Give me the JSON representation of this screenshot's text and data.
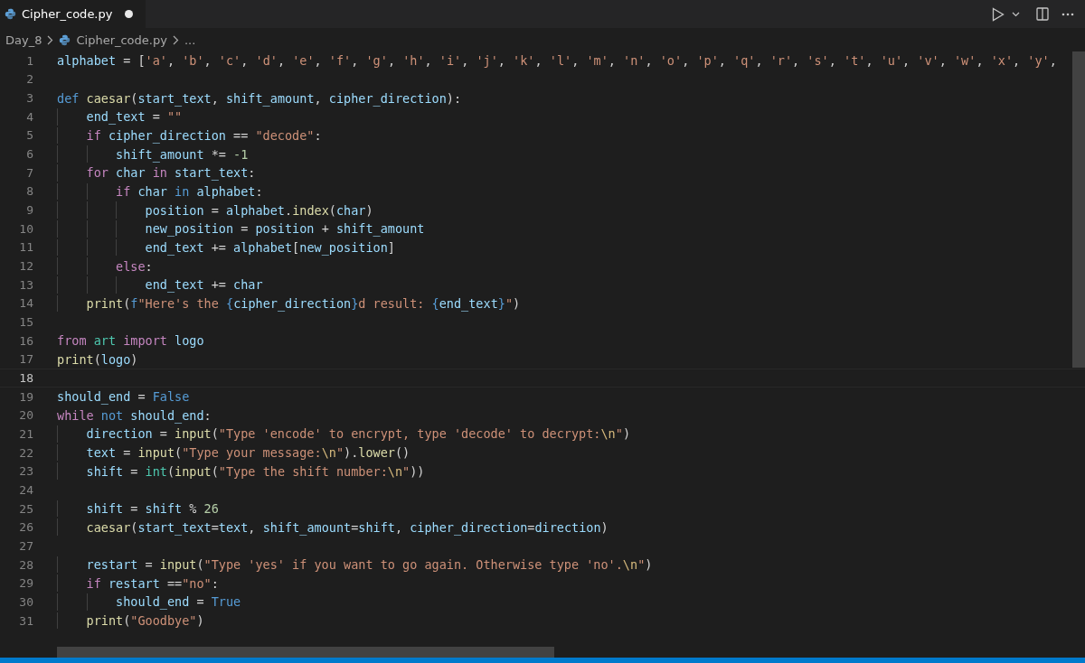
{
  "tabs": [
    {
      "label": "Cipher_code.py",
      "selected": true,
      "modified": true
    }
  ],
  "breadcrumbs": [
    "Day_8",
    "Cipher_code.py",
    "..."
  ],
  "lines": [
    {
      "number": "1",
      "current": false,
      "tokens": [
        {
          "kind": "variable",
          "text": "alphabet"
        },
        {
          "kind": "operator",
          "text": " = ["
        },
        {
          "kind": "string",
          "text": "'a'"
        },
        {
          "kind": "operator",
          "text": ", "
        },
        {
          "kind": "string",
          "text": "'b'"
        },
        {
          "kind": "operator",
          "text": ", "
        },
        {
          "kind": "string",
          "text": "'c'"
        },
        {
          "kind": "operator",
          "text": ", "
        },
        {
          "kind": "string",
          "text": "'d'"
        },
        {
          "kind": "operator",
          "text": ", "
        },
        {
          "kind": "string",
          "text": "'e'"
        },
        {
          "kind": "operator",
          "text": ", "
        },
        {
          "kind": "string",
          "text": "'f'"
        },
        {
          "kind": "operator",
          "text": ", "
        },
        {
          "kind": "string",
          "text": "'g'"
        },
        {
          "kind": "operator",
          "text": ", "
        },
        {
          "kind": "string",
          "text": "'h'"
        },
        {
          "kind": "operator",
          "text": ", "
        },
        {
          "kind": "string",
          "text": "'i'"
        },
        {
          "kind": "operator",
          "text": ", "
        },
        {
          "kind": "string",
          "text": "'j'"
        },
        {
          "kind": "operator",
          "text": ", "
        },
        {
          "kind": "string",
          "text": "'k'"
        },
        {
          "kind": "operator",
          "text": ", "
        },
        {
          "kind": "string",
          "text": "'l'"
        },
        {
          "kind": "operator",
          "text": ", "
        },
        {
          "kind": "string",
          "text": "'m'"
        },
        {
          "kind": "operator",
          "text": ", "
        },
        {
          "kind": "string",
          "text": "'n'"
        },
        {
          "kind": "operator",
          "text": ", "
        },
        {
          "kind": "string",
          "text": "'o'"
        },
        {
          "kind": "operator",
          "text": ", "
        },
        {
          "kind": "string",
          "text": "'p'"
        },
        {
          "kind": "operator",
          "text": ", "
        },
        {
          "kind": "string",
          "text": "'q'"
        },
        {
          "kind": "operator",
          "text": ", "
        },
        {
          "kind": "string",
          "text": "'r'"
        },
        {
          "kind": "operator",
          "text": ", "
        },
        {
          "kind": "string",
          "text": "'s'"
        },
        {
          "kind": "operator",
          "text": ", "
        },
        {
          "kind": "string",
          "text": "'t'"
        },
        {
          "kind": "operator",
          "text": ", "
        },
        {
          "kind": "string",
          "text": "'u'"
        },
        {
          "kind": "operator",
          "text": ", "
        },
        {
          "kind": "string",
          "text": "'v'"
        },
        {
          "kind": "operator",
          "text": ", "
        },
        {
          "kind": "string",
          "text": "'w'"
        },
        {
          "kind": "operator",
          "text": ", "
        },
        {
          "kind": "string",
          "text": "'x'"
        },
        {
          "kind": "operator",
          "text": ", "
        },
        {
          "kind": "string",
          "text": "'y'"
        },
        {
          "kind": "operator",
          "text": ","
        }
      ]
    },
    {
      "number": "2",
      "current": false
    },
    {
      "number": "3",
      "current": false,
      "tokens": [
        {
          "kind": "storage",
          "text": "def"
        },
        {
          "kind": "function",
          "text": " caesar"
        },
        {
          "kind": "operator",
          "text": "("
        },
        {
          "kind": "variable",
          "text": "start_text"
        },
        {
          "kind": "operator",
          "text": ", "
        },
        {
          "kind": "variable",
          "text": "shift_amount"
        },
        {
          "kind": "operator",
          "text": ", "
        },
        {
          "kind": "variable",
          "text": "cipher_direction"
        },
        {
          "kind": "operator",
          "text": "):"
        }
      ]
    },
    {
      "number": "4",
      "current": false,
      "tokens": [
        {
          "kind": "variable",
          "text": "    end_text"
        },
        {
          "kind": "operator",
          "text": " = "
        },
        {
          "kind": "string",
          "text": "\"\""
        }
      ]
    },
    {
      "number": "5",
      "current": false,
      "tokens": [
        {
          "kind": "keyword",
          "text": "    if"
        },
        {
          "kind": "variable",
          "text": " cipher_direction"
        },
        {
          "kind": "operator",
          "text": " == "
        },
        {
          "kind": "string",
          "text": "\"decode\""
        },
        {
          "kind": "operator",
          "text": ":"
        }
      ]
    },
    {
      "number": "6",
      "current": false,
      "tokens": [
        {
          "kind": "variable",
          "text": "        shift_amount"
        },
        {
          "kind": "operator",
          "text": " *= "
        },
        {
          "kind": "number",
          "text": "-1"
        }
      ]
    },
    {
      "number": "7",
      "current": false,
      "tokens": [
        {
          "kind": "keyword",
          "text": "    for"
        },
        {
          "kind": "variable",
          "text": " char"
        },
        {
          "kind": "keyword",
          "text": " in"
        },
        {
          "kind": "variable",
          "text": " start_text"
        },
        {
          "kind": "operator",
          "text": ":"
        }
      ]
    },
    {
      "number": "8",
      "current": false,
      "tokens": [
        {
          "kind": "keyword",
          "text": "        if"
        },
        {
          "kind": "variable",
          "text": " char"
        },
        {
          "kind": "storage",
          "text": " in"
        },
        {
          "kind": "variable",
          "text": " alphabet"
        },
        {
          "kind": "operator",
          "text": ":"
        }
      ]
    },
    {
      "number": "9",
      "current": false,
      "tokens": [
        {
          "kind": "variable",
          "text": "            position"
        },
        {
          "kind": "operator",
          "text": " = "
        },
        {
          "kind": "variable",
          "text": "alphabet"
        },
        {
          "kind": "operator",
          "text": "."
        },
        {
          "kind": "function",
          "text": "index"
        },
        {
          "kind": "operator",
          "text": "("
        },
        {
          "kind": "variable",
          "text": "char"
        },
        {
          "kind": "operator",
          "text": ")"
        }
      ]
    },
    {
      "number": "10",
      "current": false,
      "tokens": [
        {
          "kind": "variable",
          "text": "            new_position"
        },
        {
          "kind": "operator",
          "text": " = "
        },
        {
          "kind": "variable",
          "text": "position"
        },
        {
          "kind": "operator",
          "text": " + "
        },
        {
          "kind": "variable",
          "text": "shift_amount"
        }
      ]
    },
    {
      "number": "11",
      "current": false,
      "tokens": [
        {
          "kind": "variable",
          "text": "            end_text"
        },
        {
          "kind": "operator",
          "text": " += "
        },
        {
          "kind": "variable",
          "text": "alphabet"
        },
        {
          "kind": "operator",
          "text": "["
        },
        {
          "kind": "variable",
          "text": "new_position"
        },
        {
          "kind": "operator",
          "text": "]"
        }
      ]
    },
    {
      "number": "12",
      "current": false,
      "tokens": [
        {
          "kind": "keyword",
          "text": "        else"
        },
        {
          "kind": "operator",
          "text": ":"
        }
      ]
    },
    {
      "number": "13",
      "current": false,
      "tokens": [
        {
          "kind": "variable",
          "text": "            end_text"
        },
        {
          "kind": "operator",
          "text": " += "
        },
        {
          "kind": "variable",
          "text": "char"
        }
      ]
    },
    {
      "number": "14",
      "current": false,
      "tokens": [
        {
          "kind": "function",
          "text": "    print"
        },
        {
          "kind": "operator",
          "text": "("
        },
        {
          "kind": "storage",
          "text": "f"
        },
        {
          "kind": "string",
          "text": "\"Here's the "
        },
        {
          "kind": "storage",
          "text": "{"
        },
        {
          "kind": "variable",
          "text": "cipher_direction"
        },
        {
          "kind": "storage",
          "text": "}"
        },
        {
          "kind": "string",
          "text": "d result: "
        },
        {
          "kind": "storage",
          "text": "{"
        },
        {
          "kind": "variable",
          "text": "end_text"
        },
        {
          "kind": "storage",
          "text": "}"
        },
        {
          "kind": "string",
          "text": "\""
        },
        {
          "kind": "operator",
          "text": ")"
        }
      ]
    },
    {
      "number": "15",
      "current": false
    },
    {
      "number": "16",
      "current": false,
      "tokens": [
        {
          "kind": "keyword",
          "text": "from"
        },
        {
          "kind": "class",
          "text": " art"
        },
        {
          "kind": "keyword",
          "text": " import"
        },
        {
          "kind": "variable",
          "text": " logo"
        }
      ]
    },
    {
      "number": "17",
      "current": false,
      "tokens": [
        {
          "kind": "function",
          "text": "print"
        },
        {
          "kind": "operator",
          "text": "("
        },
        {
          "kind": "variable",
          "text": "logo"
        },
        {
          "kind": "operator",
          "text": ")"
        }
      ]
    },
    {
      "number": "18",
      "current": true
    },
    {
      "number": "19",
      "current": false,
      "tokens": [
        {
          "kind": "variable",
          "text": "should_end"
        },
        {
          "kind": "operator",
          "text": " = "
        },
        {
          "kind": "storage",
          "text": "False"
        }
      ]
    },
    {
      "number": "20",
      "current": false,
      "tokens": [
        {
          "kind": "keyword",
          "text": "while"
        },
        {
          "kind": "storage",
          "text": " not"
        },
        {
          "kind": "variable",
          "text": " should_end"
        },
        {
          "kind": "operator",
          "text": ":"
        }
      ]
    },
    {
      "number": "21",
      "current": false,
      "tokens": [
        {
          "kind": "variable",
          "text": "    direction"
        },
        {
          "kind": "operator",
          "text": " = "
        },
        {
          "kind": "function",
          "text": "input"
        },
        {
          "kind": "operator",
          "text": "("
        },
        {
          "kind": "string",
          "text": "\"Type 'encode' to encrypt, type 'decode' to decrypt:"
        },
        {
          "kind": "escape",
          "text": "\\n"
        },
        {
          "kind": "string",
          "text": "\""
        },
        {
          "kind": "operator",
          "text": ")"
        }
      ]
    },
    {
      "number": "22",
      "current": false,
      "tokens": [
        {
          "kind": "variable",
          "text": "    text"
        },
        {
          "kind": "operator",
          "text": " = "
        },
        {
          "kind": "function",
          "text": "input"
        },
        {
          "kind": "operator",
          "text": "("
        },
        {
          "kind": "string",
          "text": "\"Type your message:"
        },
        {
          "kind": "escape",
          "text": "\\n"
        },
        {
          "kind": "string",
          "text": "\""
        },
        {
          "kind": "operator",
          "text": ")."
        },
        {
          "kind": "function",
          "text": "lower"
        },
        {
          "kind": "operator",
          "text": "()"
        }
      ]
    },
    {
      "number": "23",
      "current": false,
      "tokens": [
        {
          "kind": "variable",
          "text": "    shift"
        },
        {
          "kind": "operator",
          "text": " = "
        },
        {
          "kind": "class",
          "text": "int"
        },
        {
          "kind": "operator",
          "text": "("
        },
        {
          "kind": "function",
          "text": "input"
        },
        {
          "kind": "operator",
          "text": "("
        },
        {
          "kind": "string",
          "text": "\"Type the shift number:"
        },
        {
          "kind": "escape",
          "text": "\\n"
        },
        {
          "kind": "string",
          "text": "\""
        },
        {
          "kind": "operator",
          "text": "))"
        }
      ]
    },
    {
      "number": "24",
      "current": false
    },
    {
      "number": "25",
      "current": false,
      "tokens": [
        {
          "kind": "variable",
          "text": "    shift"
        },
        {
          "kind": "operator",
          "text": " = "
        },
        {
          "kind": "variable",
          "text": "shift"
        },
        {
          "kind": "operator",
          "text": " % "
        },
        {
          "kind": "number",
          "text": "26"
        }
      ]
    },
    {
      "number": "26",
      "current": false,
      "tokens": [
        {
          "kind": "function",
          "text": "    caesar"
        },
        {
          "kind": "operator",
          "text": "("
        },
        {
          "kind": "variable",
          "text": "start_text"
        },
        {
          "kind": "operator",
          "text": "="
        },
        {
          "kind": "variable",
          "text": "text"
        },
        {
          "kind": "operator",
          "text": ", "
        },
        {
          "kind": "variable",
          "text": "shift_amount"
        },
        {
          "kind": "operator",
          "text": "="
        },
        {
          "kind": "variable",
          "text": "shift"
        },
        {
          "kind": "operator",
          "text": ", "
        },
        {
          "kind": "variable",
          "text": "cipher_direction"
        },
        {
          "kind": "operator",
          "text": "="
        },
        {
          "kind": "variable",
          "text": "direction"
        },
        {
          "kind": "operator",
          "text": ")"
        }
      ]
    },
    {
      "number": "27",
      "current": false
    },
    {
      "number": "28",
      "current": false,
      "tokens": [
        {
          "kind": "variable",
          "text": "    restart"
        },
        {
          "kind": "operator",
          "text": " = "
        },
        {
          "kind": "function",
          "text": "input"
        },
        {
          "kind": "operator",
          "text": "("
        },
        {
          "kind": "string",
          "text": "\"Type 'yes' if you want to go again. Otherwise type 'no'."
        },
        {
          "kind": "escape",
          "text": "\\n"
        },
        {
          "kind": "string",
          "text": "\""
        },
        {
          "kind": "operator",
          "text": ")"
        }
      ]
    },
    {
      "number": "29",
      "current": false,
      "tokens": [
        {
          "kind": "keyword",
          "text": "    if"
        },
        {
          "kind": "variable",
          "text": " restart"
        },
        {
          "kind": "operator",
          "text": " =="
        },
        {
          "kind": "string",
          "text": "\"no\""
        },
        {
          "kind": "operator",
          "text": ":"
        }
      ]
    },
    {
      "number": "30",
      "current": false,
      "tokens": [
        {
          "kind": "variable",
          "text": "        should_end"
        },
        {
          "kind": "operator",
          "text": " = "
        },
        {
          "kind": "storage",
          "text": "True"
        }
      ]
    },
    {
      "number": "31",
      "current": false,
      "tokens": [
        {
          "kind": "function",
          "text": "    print"
        },
        {
          "kind": "operator",
          "text": "("
        },
        {
          "kind": "string",
          "text": "\"Goodbye\""
        },
        {
          "kind": "operator",
          "text": ")"
        }
      ]
    }
  ]
}
